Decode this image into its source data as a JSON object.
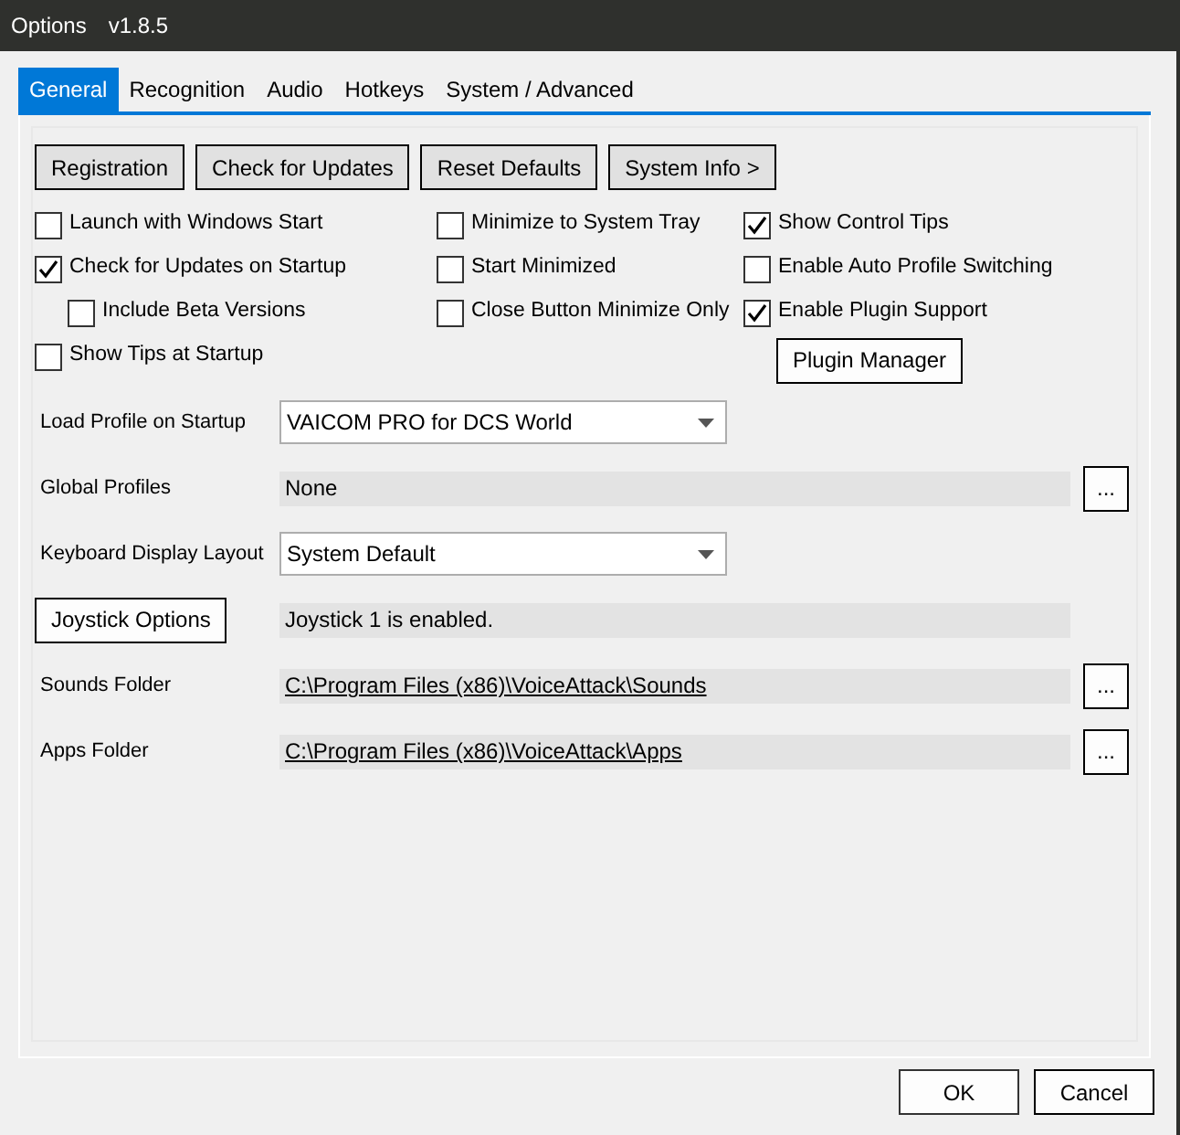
{
  "window": {
    "title": "Options",
    "version": "v1.8.5"
  },
  "tabs": [
    {
      "label": "General",
      "selected": true
    },
    {
      "label": "Recognition",
      "selected": false
    },
    {
      "label": "Audio",
      "selected": false
    },
    {
      "label": "Hotkeys",
      "selected": false
    },
    {
      "label": "System / Advanced",
      "selected": false
    }
  ],
  "top_buttons": [
    "Registration",
    "Check for Updates",
    "Reset Defaults",
    "System Info >"
  ],
  "option_columns": [
    [
      {
        "kind": "checkbox",
        "label": "Launch with Windows Start",
        "checked": false
      },
      {
        "kind": "checkbox",
        "label": "Check for Updates on Startup",
        "checked": true,
        "children": [
          {
            "kind": "checkbox",
            "label": "Include Beta Versions",
            "checked": false
          }
        ]
      },
      {
        "kind": "checkbox",
        "label": "Show Tips at Startup",
        "checked": false
      }
    ],
    [
      {
        "kind": "checkbox",
        "label": "Minimize to System Tray",
        "checked": false
      },
      {
        "kind": "checkbox",
        "label": "Start Minimized",
        "checked": false
      },
      {
        "kind": "checkbox",
        "label": "Close Button Minimize Only",
        "checked": false
      }
    ],
    [
      {
        "kind": "checkbox",
        "label": "Show Control Tips",
        "checked": true
      },
      {
        "kind": "checkbox",
        "label": "Enable Auto Profile Switching",
        "checked": false
      },
      {
        "kind": "checkbox",
        "label": "Enable Plugin Support",
        "checked": true
      },
      {
        "kind": "button",
        "label": "Plugin Manager"
      }
    ]
  ],
  "settings": [
    {
      "kind": "dropdown",
      "label": "Load Profile on Startup",
      "value": "VAICOM PRO for DCS World"
    },
    {
      "kind": "readonly",
      "label": "Global Profiles",
      "value": "None",
      "browse": "..."
    },
    {
      "kind": "dropdown",
      "label": "Keyboard Display Layout",
      "value": "System Default"
    },
    {
      "kind": "button",
      "label": "Joystick Options",
      "value": "Joystick 1 is enabled."
    },
    {
      "kind": "path",
      "label": "Sounds Folder",
      "value": "C:\\Program Files (x86)\\VoiceAttack\\Sounds",
      "browse": "..."
    },
    {
      "kind": "path",
      "label": "Apps Folder",
      "value": "C:\\Program Files (x86)\\VoiceAttack\\Apps",
      "browse": "..."
    }
  ],
  "footer_buttons": [
    "OK",
    "Cancel"
  ]
}
